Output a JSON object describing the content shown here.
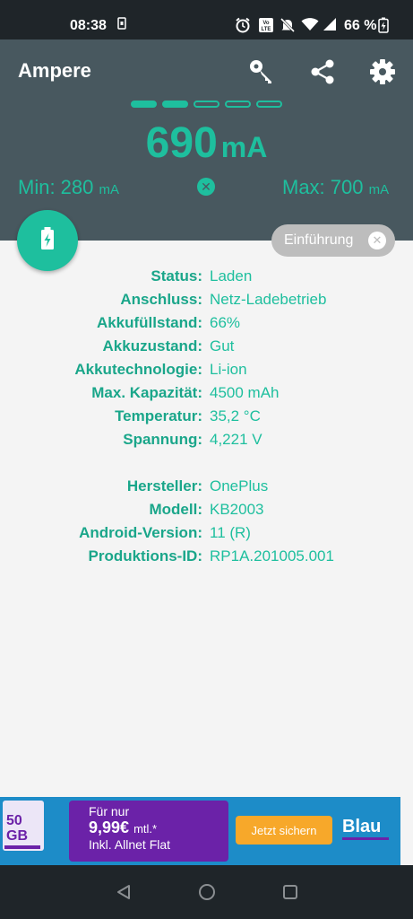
{
  "status_bar": {
    "time": "08:38",
    "battery_percent": "66 %",
    "icons": [
      "alarm-icon",
      "volte-icon",
      "mute-icon",
      "wifi-icon",
      "signal-icon",
      "battery-charging-icon"
    ]
  },
  "app": {
    "title": "Ampere",
    "accent_color": "#1ebf9e",
    "header_color": "#48585f"
  },
  "meter": {
    "level_indicator": {
      "filled": 2,
      "total": 5
    },
    "current_value": "690",
    "current_unit": "mA",
    "min_label": "Min: 280",
    "min_unit": "mA",
    "max_label": "Max: 700",
    "max_unit": "mA"
  },
  "intro_chip": {
    "label": "Einführung"
  },
  "battery_info": [
    {
      "label": "Status:",
      "value": "Laden"
    },
    {
      "label": "Anschluss:",
      "value": "Netz-Ladebetrieb"
    },
    {
      "label": "Akkufüllstand:",
      "value": "66%"
    },
    {
      "label": "Akkuzustand:",
      "value": "Gut"
    },
    {
      "label": "Akkutechnologie:",
      "value": "Li-ion"
    },
    {
      "label": "Max. Kapazität:",
      "value": "4500 mAh"
    },
    {
      "label": "Temperatur:",
      "value": "35,2 °C"
    },
    {
      "label": "Spannung:",
      "value": "4,221 V"
    }
  ],
  "device_info": [
    {
      "label": "Hersteller:",
      "value": "OnePlus"
    },
    {
      "label": "Modell:",
      "value": "KB2003"
    },
    {
      "label": "Android-Version:",
      "value": "11 (R)"
    },
    {
      "label": "Produktions-ID:",
      "value": "RP1A.201005.001"
    }
  ],
  "ad": {
    "sim_label": "50 GB",
    "line1": "Für nur",
    "price": "9,99€",
    "price_suffix": "mtl.*",
    "line3": "Inkl. Allnet Flat",
    "cta": "Jetzt sichern",
    "brand": "Blau"
  }
}
